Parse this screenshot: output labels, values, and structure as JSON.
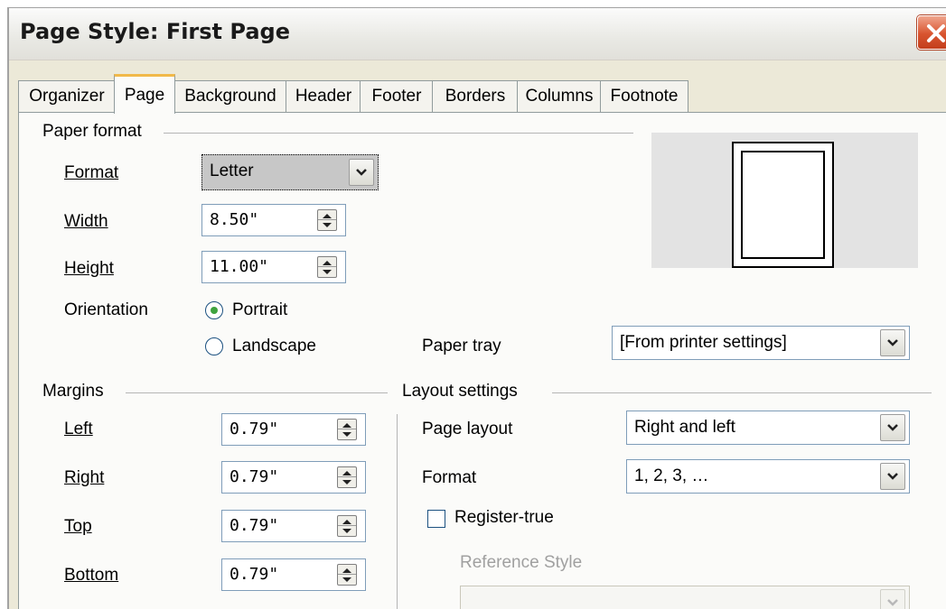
{
  "window": {
    "title": "Page Style: First Page"
  },
  "tabs": [
    "Organizer",
    "Page",
    "Background",
    "Header",
    "Footer",
    "Borders",
    "Columns",
    "Footnote"
  ],
  "paper_format": {
    "section_label": "Paper format",
    "format_label": "Format",
    "format_value": "Letter",
    "width_label": "Width",
    "width_value": "8.50\"",
    "height_label": "Height",
    "height_value": "11.00\"",
    "orientation_label": "Orientation",
    "portrait_label": "Portrait",
    "landscape_label": "Landscape",
    "selected_orientation": "Portrait",
    "paper_tray_label": "Paper tray",
    "paper_tray_value": "[From printer settings]"
  },
  "margins": {
    "section_label": "Margins",
    "left_label": "Left",
    "left_value": "0.79\"",
    "right_label": "Right",
    "right_value": "0.79\"",
    "top_label": "Top",
    "top_value": "0.79\"",
    "bottom_label": "Bottom",
    "bottom_value": "0.79\""
  },
  "layout_settings": {
    "section_label": "Layout settings",
    "page_layout_label": "Page layout",
    "page_layout_value": "Right and left",
    "format_label": "Format",
    "format_value": "1, 2, 3, …",
    "register_true_label": "Register-true",
    "register_true_checked": false,
    "reference_style_label": "Reference Style",
    "reference_style_value": ""
  },
  "colors": {
    "dialog_bg": "#ece9d8",
    "tab_accent": "#f1b94a",
    "close_button": "#d8542f",
    "radio_selected": "#3fa33f"
  }
}
